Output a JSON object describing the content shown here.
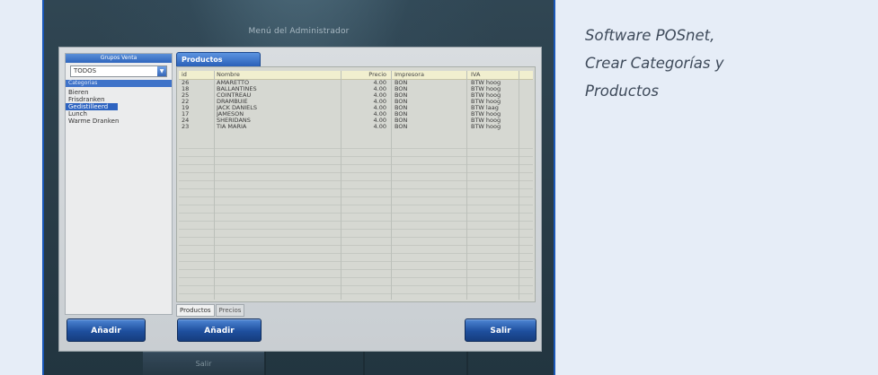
{
  "window": {
    "title": "Menú del Administrador"
  },
  "categories_panel": {
    "group_header": "Grupos Venta",
    "group_selected": "TODOS",
    "dropdown_glyph": "▼",
    "categories_header": "Categorias",
    "items": [
      {
        "label": "Bieren",
        "selected": false
      },
      {
        "label": "Frisdranken",
        "selected": false
      },
      {
        "label": "Gedistilleerd",
        "selected": true
      },
      {
        "label": "Lunch",
        "selected": false
      },
      {
        "label": "Warme Dranken",
        "selected": false
      }
    ]
  },
  "products_panel": {
    "tab_label": "Productos",
    "columns": {
      "id": "id",
      "name": "Nombre",
      "price": "Precio",
      "printer": "Impresora",
      "iva": "IVA"
    },
    "rows": [
      {
        "id": "26",
        "name": "AMARETTO",
        "price": "4.00",
        "printer": "BON",
        "iva": "BTW hoog"
      },
      {
        "id": "18",
        "name": "BALLANTINES",
        "price": "4.00",
        "printer": "BON",
        "iva": "BTW hoog"
      },
      {
        "id": "25",
        "name": "COINTREAU",
        "price": "4.00",
        "printer": "BON",
        "iva": "BTW hoog"
      },
      {
        "id": "22",
        "name": "DRAMBUIE",
        "price": "4.00",
        "printer": "BON",
        "iva": "BTW hoog"
      },
      {
        "id": "19",
        "name": "JACK DANIELS",
        "price": "4.00",
        "printer": "BON",
        "iva": "BTW laag"
      },
      {
        "id": "17",
        "name": "JAMESON",
        "price": "4.00",
        "printer": "BON",
        "iva": "BTW hoog"
      },
      {
        "id": "24",
        "name": "SHERIDANS",
        "price": "4.00",
        "printer": "BON",
        "iva": "BTW hoog"
      },
      {
        "id": "23",
        "name": "TIA MARIA",
        "price": "4.00",
        "printer": "BON",
        "iva": "BTW hoog"
      }
    ],
    "bottom_tabs": [
      "Productos",
      "Precios"
    ]
  },
  "buttons": {
    "add_category": "Añadir",
    "add_product": "Añadir",
    "exit": "Salir"
  },
  "background_exit": "Salir",
  "caption": {
    "line1": "Software POSnet,",
    "line2": "Crear Categorías y",
    "line3": "Productos"
  },
  "colors": {
    "accent": "#2d63c0",
    "frame": "#1a57b8",
    "page_bg": "#e6edf7"
  }
}
